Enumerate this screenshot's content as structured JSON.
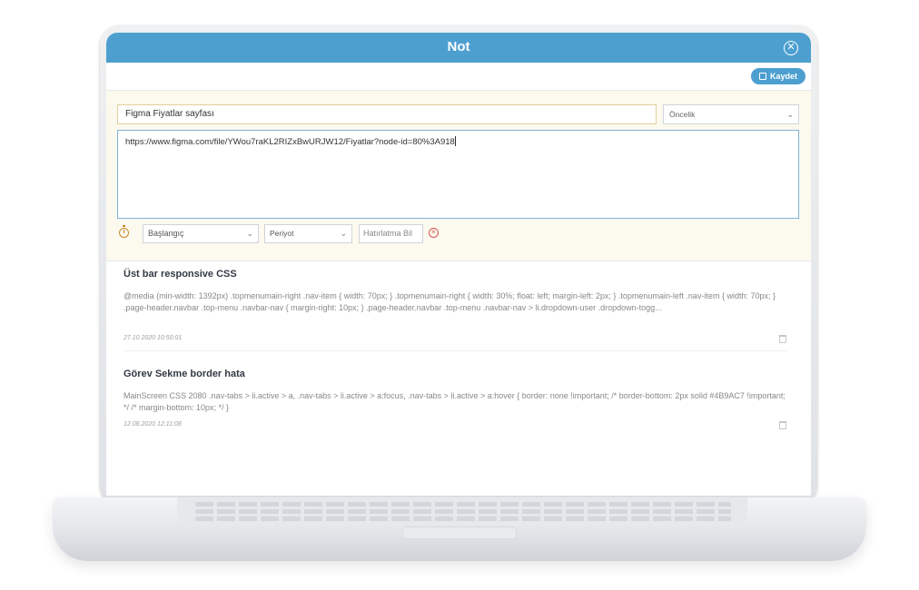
{
  "dialog": {
    "title": "Not",
    "close_icon": "close-circle-icon",
    "save_label": "Kaydet",
    "save_icon": "floppy-disk-icon"
  },
  "form": {
    "title_value": "Figma Fiyatlar sayfası",
    "priority_placeholder": "Öncelik",
    "note_text": "https://www.figma.com/file/YWou7raKL2RIZxBwURJW12/Fiyatlar?node-id=80%3A918",
    "start_label": "Başlangıç",
    "period_label": "Periyot",
    "reminder_placeholder": "Hatırlatma Bil",
    "timer_icon": "stopwatch-icon",
    "clear_icon": "clear-circle-icon"
  },
  "notes": [
    {
      "title": "Üst bar responsive CSS",
      "body": "@media (min-width: 1392px) .topmenumain-right .nav-item { width: 70px; } .topmenumain-right { width: 30%; float: left; margin-left: 2px; } .topmenumain-left .nav-item { width: 70px; } .page-header.navbar .top-menu .navbar-nav { margin-right: 10px; } .page-header.navbar .top-menu .navbar-nav > li.dropdown-user .dropdown-togg...",
      "date": "27.10.2020 10:50:01"
    },
    {
      "title": "Görev Sekme border hata",
      "body": "MainScreen CSS 2080 .nav-tabs > li.active > a, .nav-tabs > li.active > a:focus, .nav-tabs > li.active > a:hover { border: none !important; /* border-bottom: 2px solid #4B9AC7 !important; */ /* margin-bottom: 10px; */ }",
      "date": "12.08.2020 12:11:08"
    }
  ],
  "colors": {
    "header": "#4d9fd0",
    "panel": "#fcf9ee",
    "danger": "#d9534f"
  }
}
